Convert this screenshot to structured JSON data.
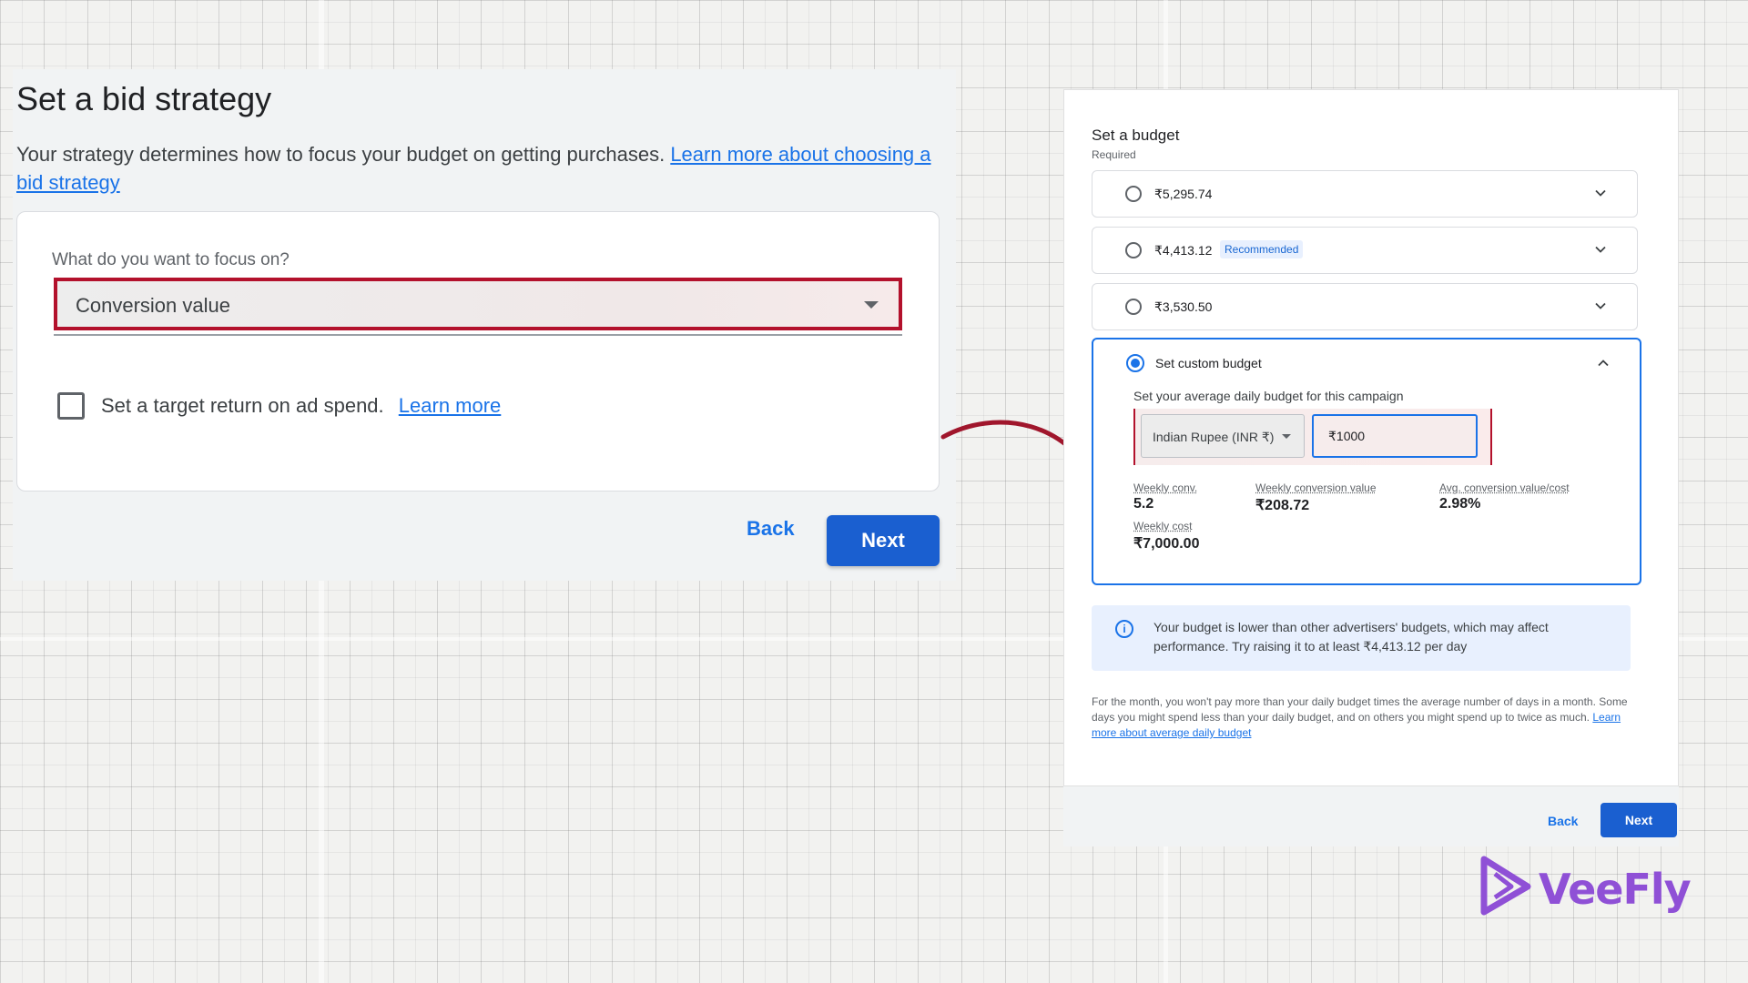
{
  "bid_strategy": {
    "title": "Set a bid strategy",
    "description": "Your strategy determines how to focus your budget on getting purchases.",
    "description_link": "Learn more about choosing a bid strategy",
    "focus_label": "What do you want to focus on?",
    "focus_value": "Conversion value",
    "target_roas_label": "Set a target return on ad spend.",
    "target_roas_link": "Learn more",
    "target_roas_checked": false,
    "back_label": "Back",
    "next_label": "Next"
  },
  "budget": {
    "title": "Set a budget",
    "required": "Required",
    "options": [
      {
        "amount": "₹5,295.74",
        "badge": ""
      },
      {
        "amount": "₹4,413.12",
        "badge": "Recommended"
      },
      {
        "amount": "₹3,530.50",
        "badge": ""
      }
    ],
    "custom": {
      "label": "Set custom budget",
      "selected": true,
      "avg_daily_label": "Set your average daily budget for this campaign",
      "currency": "Indian Rupee (INR ₹)",
      "amount_value": "₹1000",
      "metrics": {
        "weekly_conv_label": "Weekly conv.",
        "weekly_conv_value": "5.2",
        "weekly_conv_value_label": "Weekly conversion value",
        "weekly_conv_value_value": "₹208.72",
        "avg_conv_value_cost_label": "Avg. conversion value/cost",
        "avg_conv_value_cost_value": "2.98%",
        "weekly_cost_label": "Weekly cost",
        "weekly_cost_value": "₹7,000.00"
      }
    },
    "info_message": "Your budget is lower than other advertisers' budgets, which may affect performance. Try raising it to at least ₹4,413.12 per day",
    "footnote": "For the month, you won't pay more than your daily budget times the average number of days in a month. Some days you might spend less than your daily budget, and on others you might spend up to twice as much.",
    "footnote_link": "Learn more about average daily budget",
    "back_label": "Back",
    "next_label": "Next"
  },
  "brand": {
    "name": "VeeFly",
    "color": "#8f50d6"
  },
  "colors": {
    "accent": "#1a73e8",
    "highlight": "#b3112c"
  }
}
